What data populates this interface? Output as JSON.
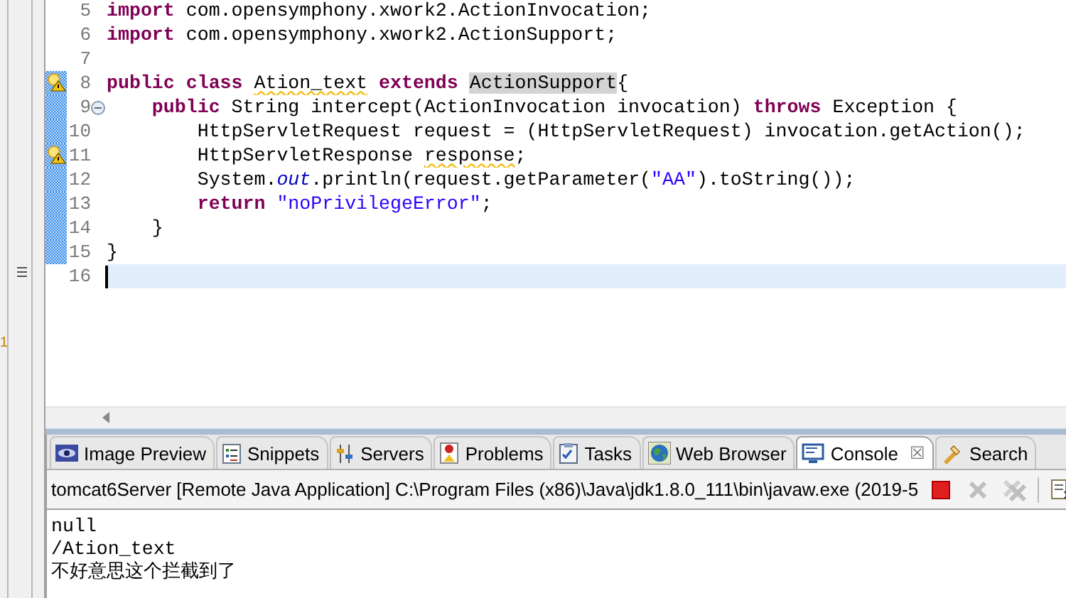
{
  "left_strip": {
    "badge": "1"
  },
  "editor": {
    "lines": [
      {
        "number": "5",
        "changed": false,
        "warning": false,
        "fold": false,
        "current": false,
        "tokens": [
          {
            "text": "import",
            "kind": "keyword"
          },
          {
            "text": " com.opensymphony.xwork2.ActionInvocation;",
            "kind": "plain"
          }
        ]
      },
      {
        "number": "6",
        "changed": false,
        "warning": false,
        "fold": false,
        "current": false,
        "tokens": [
          {
            "text": "import",
            "kind": "keyword"
          },
          {
            "text": " com.opensymphony.xwork2.ActionSupport;",
            "kind": "plain"
          }
        ]
      },
      {
        "number": "7",
        "changed": false,
        "warning": false,
        "fold": false,
        "current": false
      },
      {
        "number": "8",
        "changed": true,
        "warning": true,
        "fold": false,
        "current": false,
        "tokens": [
          {
            "text": "public class ",
            "kind": "keyword"
          },
          {
            "text": "Ation_text",
            "kind": "warning"
          },
          {
            "text": " extends ",
            "kind": "keyword"
          },
          {
            "text": "ActionSupport",
            "kind": "occurrence"
          },
          {
            "text": "{",
            "kind": "plain"
          }
        ]
      },
      {
        "number": "9",
        "changed": true,
        "warning": false,
        "fold": true,
        "current": false,
        "tokens": [
          {
            "text": "    public",
            "kind": "keyword"
          },
          {
            "text": " String intercept(ActionInvocation invocation) ",
            "kind": "plain"
          },
          {
            "text": "throws",
            "kind": "keyword"
          },
          {
            "text": " Exception {",
            "kind": "plain"
          }
        ]
      },
      {
        "number": "10",
        "changed": true,
        "warning": false,
        "fold": false,
        "current": false,
        "tokens": [
          {
            "text": "        HttpServletRequest request = (HttpServletRequest) invocation.getAction();",
            "kind": "plain"
          }
        ]
      },
      {
        "number": "11",
        "changed": true,
        "warning": true,
        "fold": false,
        "current": false,
        "tokens": [
          {
            "text": "        HttpServletResponse ",
            "kind": "plain"
          },
          {
            "text": "response",
            "kind": "warning"
          },
          {
            "text": ";",
            "kind": "plain"
          }
        ]
      },
      {
        "number": "12",
        "changed": true,
        "warning": false,
        "fold": false,
        "current": false,
        "tokens": [
          {
            "text": "        System.",
            "kind": "plain"
          },
          {
            "text": "out",
            "kind": "field"
          },
          {
            "text": ".println(request.getParameter(",
            "kind": "plain"
          },
          {
            "text": "\"AA\"",
            "kind": "string"
          },
          {
            "text": ").toString());",
            "kind": "plain"
          }
        ]
      },
      {
        "number": "13",
        "changed": true,
        "warning": false,
        "fold": false,
        "current": false,
        "tokens": [
          {
            "text": "        return ",
            "kind": "keyword"
          },
          {
            "text": "\"noPrivilegeError\"",
            "kind": "string"
          },
          {
            "text": ";",
            "kind": "plain"
          }
        ]
      },
      {
        "number": "14",
        "changed": true,
        "warning": false,
        "fold": false,
        "current": false,
        "tokens": [
          {
            "text": "    }",
            "kind": "plain"
          }
        ]
      },
      {
        "number": "15",
        "changed": true,
        "warning": false,
        "fold": false,
        "current": false,
        "tokens": [
          {
            "text": "}",
            "kind": "plain"
          }
        ]
      },
      {
        "number": "16",
        "changed": false,
        "warning": false,
        "fold": false,
        "current": true
      }
    ]
  },
  "views": {
    "tabs": [
      {
        "label": "Image Preview",
        "selected": false,
        "closable": false
      },
      {
        "label": "Snippets",
        "selected": false,
        "closable": false
      },
      {
        "label": "Servers",
        "selected": false,
        "closable": false
      },
      {
        "label": "Problems",
        "selected": false,
        "closable": false
      },
      {
        "label": "Tasks",
        "selected": false,
        "closable": false
      },
      {
        "label": "Web Browser",
        "selected": false,
        "closable": false
      },
      {
        "label": "Console",
        "selected": true,
        "closable": true,
        "close": "☒"
      },
      {
        "label": "Search",
        "selected": false,
        "closable": false
      }
    ]
  },
  "console": {
    "process": "tomcat6Server [Remote Java Application] C:\\Program Files (x86)\\Java\\jdk1.8.0_111\\bin\\javaw.exe (2019-5",
    "toolbar": [
      {
        "kind": "terminate",
        "disabled": false
      },
      {
        "kind": "remove",
        "disabled": true
      },
      {
        "kind": "remove-all",
        "disabled": true
      },
      {
        "kind": "separator"
      },
      {
        "kind": "clear"
      }
    ],
    "output": [
      "null",
      "/Ation_text",
      "不好意思这个拦截到了"
    ]
  }
}
